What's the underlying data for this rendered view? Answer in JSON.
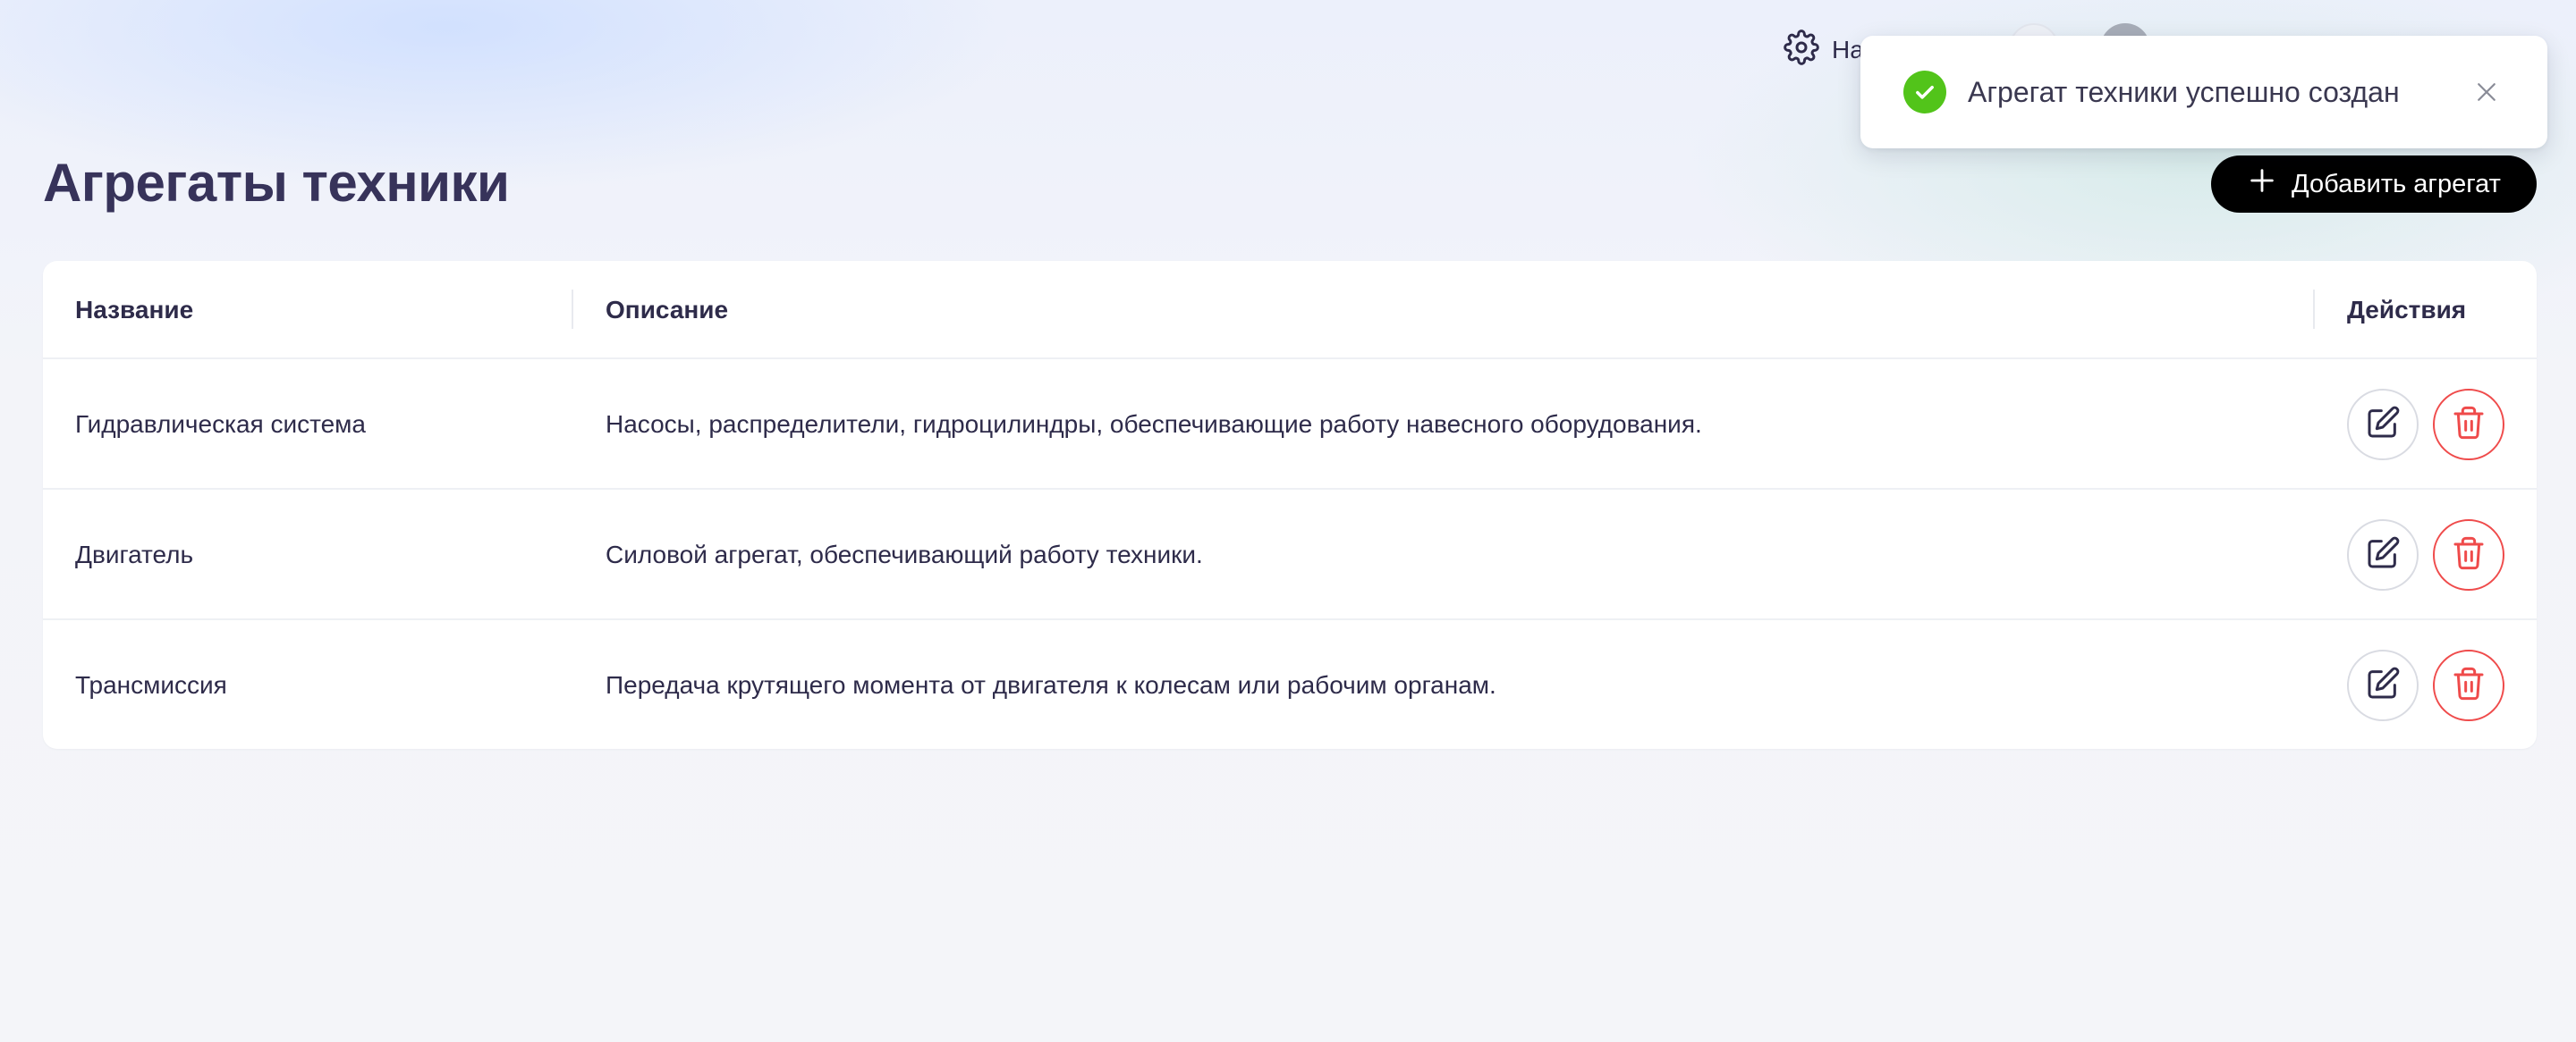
{
  "header": {
    "settings_label": "На",
    "settings_icon": "gear-icon",
    "bell_icon": "bell-icon",
    "avatar": "avatar"
  },
  "page": {
    "title": "Агрегаты техники",
    "add_button_label": "Добавить агрегат",
    "add_button_icon": "plus-icon"
  },
  "table": {
    "columns": [
      "Название",
      "Описание",
      "Действия"
    ],
    "rows": [
      {
        "name": "Гидравлическая система",
        "description": "Насосы, распределители, гидроцилиндры, обеспечивающие работу навесного оборудования."
      },
      {
        "name": "Двигатель",
        "description": "Силовой агрегат, обеспечивающий работу техники."
      },
      {
        "name": "Трансмиссия",
        "description": "Передача крутящего момента от двигателя к колесам или рабочим органам."
      }
    ],
    "row_actions": [
      "edit-icon",
      "trash-icon"
    ]
  },
  "toast": {
    "message": "Агрегат техники успешно создан",
    "status": "success",
    "status_color": "#52c41a"
  },
  "colors": {
    "primary_button": "#000000",
    "danger": "#ef4b4b",
    "title": "#37335a"
  }
}
